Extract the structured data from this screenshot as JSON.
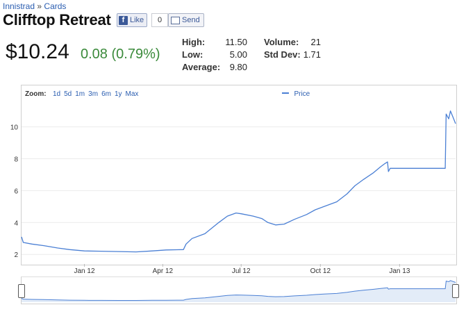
{
  "breadcrumb": {
    "set": "Innistrad",
    "separator": "»",
    "section": "Cards"
  },
  "card": {
    "title": "Clifftop Retreat"
  },
  "social": {
    "like_label": "Like",
    "like_count": "0",
    "send_label": "Send"
  },
  "quote": {
    "price": "$10.24",
    "change": "0.08 (0.79%)"
  },
  "stats": {
    "high_label": "High:",
    "high": "11.50",
    "low_label": "Low:",
    "low": "5.00",
    "average_label": "Average:",
    "average": "9.80",
    "volume_label": "Volume:",
    "volume": "21",
    "stddev_label": "Std Dev:",
    "stddev": "1.71"
  },
  "zoom": {
    "label": "Zoom:",
    "options": [
      "1d",
      "5d",
      "1m",
      "3m",
      "6m",
      "1y",
      "Max"
    ]
  },
  "colors": {
    "line": "#4a7fd4",
    "link": "#2a5db0",
    "positive": "#3a8a3a"
  },
  "chart_data": {
    "type": "line",
    "title": "",
    "xlabel": "",
    "ylabel": "",
    "legend": {
      "entries": [
        "Price"
      ],
      "placement": "top-right"
    },
    "grid": true,
    "ylim": [
      1.4,
      11.9
    ],
    "xlim": [
      "2011-10-20",
      "2013-03-07"
    ],
    "y_ticks": [
      2,
      4,
      6,
      8,
      10
    ],
    "x_ticks": [
      {
        "label": "Jan 12",
        "date": "2012-01-01"
      },
      {
        "label": "Apr 12",
        "date": "2012-04-01"
      },
      {
        "label": "Jul 12",
        "date": "2012-07-01"
      },
      {
        "label": "Oct 12",
        "date": "2012-10-01"
      },
      {
        "label": "Jan 13",
        "date": "2013-01-01"
      }
    ],
    "series": [
      {
        "name": "Price",
        "points": [
          [
            "2011-10-20",
            3.1
          ],
          [
            "2011-10-22",
            2.75
          ],
          [
            "2011-11-01",
            2.65
          ],
          [
            "2011-11-15",
            2.55
          ],
          [
            "2011-12-01",
            2.4
          ],
          [
            "2011-12-15",
            2.3
          ],
          [
            "2012-01-01",
            2.22
          ],
          [
            "2012-01-20",
            2.2
          ],
          [
            "2012-02-10",
            2.18
          ],
          [
            "2012-03-01",
            2.16
          ],
          [
            "2012-03-20",
            2.22
          ],
          [
            "2012-04-05",
            2.28
          ],
          [
            "2012-04-25",
            2.3
          ],
          [
            "2012-04-28",
            2.65
          ],
          [
            "2012-05-05",
            3.0
          ],
          [
            "2012-05-20",
            3.3
          ],
          [
            "2012-06-05",
            4.0
          ],
          [
            "2012-06-15",
            4.4
          ],
          [
            "2012-06-25",
            4.6
          ],
          [
            "2012-07-01",
            4.55
          ],
          [
            "2012-07-15",
            4.4
          ],
          [
            "2012-07-25",
            4.25
          ],
          [
            "2012-08-01",
            4.0
          ],
          [
            "2012-08-10",
            3.85
          ],
          [
            "2012-08-20",
            3.9
          ],
          [
            "2012-09-01",
            4.2
          ],
          [
            "2012-09-15",
            4.5
          ],
          [
            "2012-09-25",
            4.8
          ],
          [
            "2012-10-05",
            5.0
          ],
          [
            "2012-10-20",
            5.3
          ],
          [
            "2012-11-01",
            5.8
          ],
          [
            "2012-11-10",
            6.3
          ],
          [
            "2012-11-20",
            6.7
          ],
          [
            "2012-12-01",
            7.1
          ],
          [
            "2012-12-10",
            7.5
          ],
          [
            "2012-12-15",
            7.7
          ],
          [
            "2012-12-18",
            7.8
          ],
          [
            "2012-12-19",
            7.2
          ],
          [
            "2012-12-21",
            7.4
          ],
          [
            "2013-01-01",
            7.4
          ],
          [
            "2013-02-01",
            7.4
          ],
          [
            "2013-02-23",
            7.4
          ],
          [
            "2013-02-24",
            10.8
          ],
          [
            "2013-02-27",
            10.5
          ],
          [
            "2013-03-01",
            11.0
          ],
          [
            "2013-03-04",
            10.6
          ],
          [
            "2013-03-07",
            10.2
          ]
        ]
      }
    ]
  }
}
